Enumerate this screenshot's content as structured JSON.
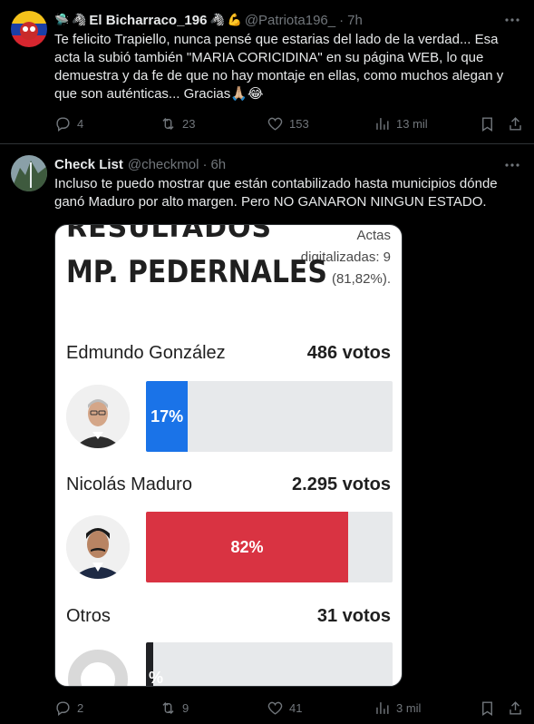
{
  "tweets": [
    {
      "name": "El Bicharraco_196",
      "handle": "@Patriota196_",
      "time": "7h",
      "text": "Te felicito Trapiello, nunca pensé que estarias del lado de la verdad... Esa acta la subió también \"MARIA CORICIDINA\" en su página WEB, lo que demuestra y da fe de que no hay montaje en ellas, como muchos alegan y que son auténticas...  Gracias🙏🏼😂",
      "stats": {
        "replies": "4",
        "reposts": "23",
        "likes": "153",
        "views": "13 mil"
      }
    },
    {
      "name": "Check List",
      "handle": "@checkmol",
      "time": "6h",
      "text": "Incluso te puedo mostrar que están contabilizado hasta municipios dónde ganó Maduro por alto margen. Pero NO GANARON NINGUN ESTADO.",
      "stats": {
        "replies": "2",
        "reposts": "9",
        "likes": "41",
        "views": "3 mil"
      },
      "media": {
        "top_text": "RESULTADOS",
        "title": "MP. PEDERNALES",
        "actas_label": "Actas digitalizadas: 9 (81,82%).",
        "candidates": [
          {
            "name": "Edmundo González",
            "votes": "486 votos",
            "pct_label": "17%",
            "pct": 0.17,
            "color": "#1a73e8"
          },
          {
            "name": "Nicolás Maduro",
            "votes": "2.295 votos",
            "pct_label": "82%",
            "pct": 0.82,
            "color": "#d93342"
          },
          {
            "name": "Otros",
            "votes": "31 votos",
            "pct_label": "%",
            "pct": 0.03,
            "color": "#202124"
          }
        ]
      }
    }
  ],
  "icons": {
    "reply": "reply-icon",
    "repost": "repost-icon",
    "like": "heart-icon",
    "views": "views-icon",
    "bookmark": "bookmark-icon",
    "share": "share-icon",
    "more": "more-icon"
  },
  "colors": {
    "background": "#000000",
    "text": "#e7e9ea",
    "muted": "#71767b",
    "divider": "#2f3336"
  }
}
